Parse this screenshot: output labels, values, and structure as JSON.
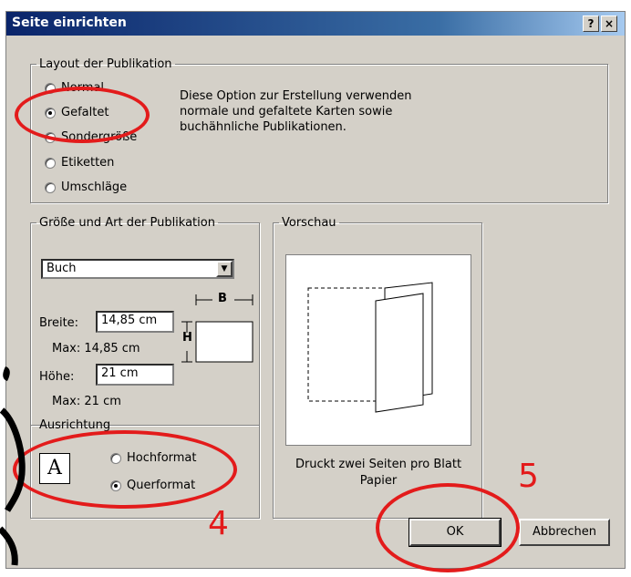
{
  "window": {
    "title": "Seite einrichten",
    "help_label": "?",
    "close_label": "×"
  },
  "layout_group": {
    "legend": "Layout der Publikation",
    "options": [
      {
        "label": "Normal",
        "selected": false
      },
      {
        "label": "Gefaltet",
        "selected": true
      },
      {
        "label": "Sondergröße",
        "selected": false
      },
      {
        "label": "Etiketten",
        "selected": false
      },
      {
        "label": "Umschläge",
        "selected": false
      }
    ],
    "description": "Diese Option zur Erstellung verwenden normale und gefaltete Karten sowie buchähnliche Publikationen."
  },
  "size_group": {
    "legend": "Größe und Art der Publikation",
    "type_value": "Buch",
    "width_label": "Breite:",
    "width_value": "14,85 cm",
    "width_max": "Max: 14,85 cm",
    "height_label": "Höhe:",
    "height_value": "21 cm",
    "height_max": "Max: 21 cm",
    "diagram_b": "B",
    "diagram_h": "H"
  },
  "orientation_group": {
    "legend": "Ausrichtung",
    "icon_letter": "A",
    "options": [
      {
        "label": "Hochformat",
        "selected": false
      },
      {
        "label": "Querformat",
        "selected": true
      }
    ]
  },
  "preview_group": {
    "legend": "Vorschau",
    "caption": "Druckt zwei Seiten pro Blatt Papier"
  },
  "buttons": {
    "ok": "OK",
    "cancel": "Abbrechen"
  },
  "annotations": {
    "step4": "4",
    "step5": "5"
  },
  "colors": {
    "annotation": "#e31b1b",
    "title_bar": "#0a246a"
  }
}
